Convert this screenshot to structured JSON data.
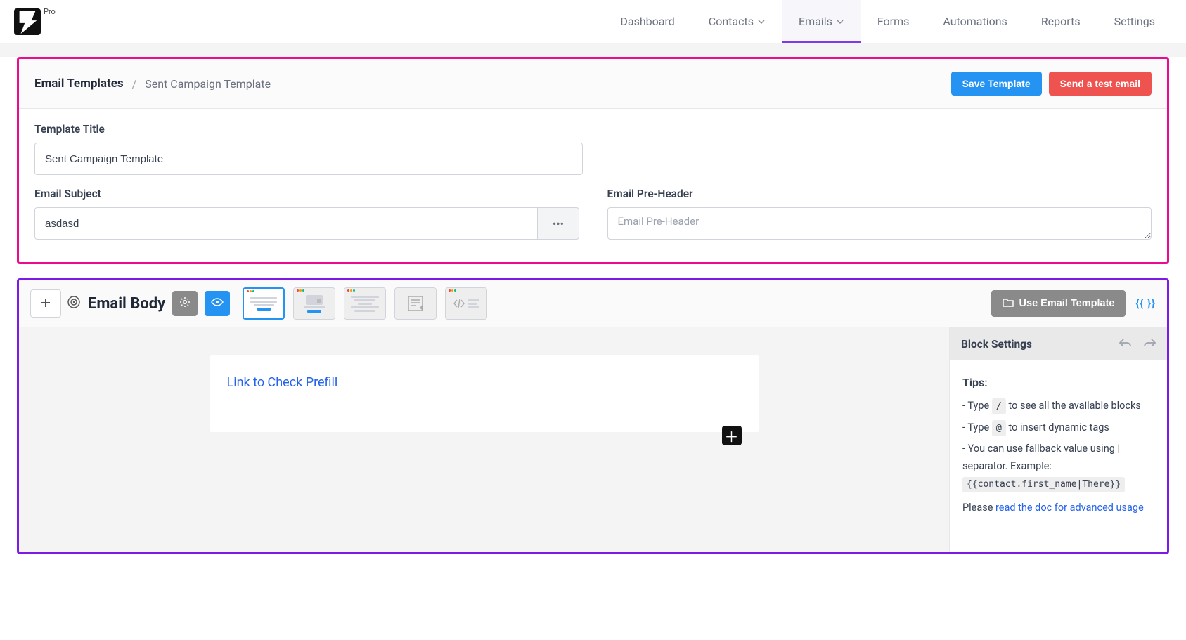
{
  "brand": {
    "badge": "Pro"
  },
  "nav": {
    "dashboard": "Dashboard",
    "contacts": "Contacts",
    "emails": "Emails",
    "forms": "Forms",
    "automations": "Automations",
    "reports": "Reports",
    "settings": "Settings"
  },
  "header": {
    "breadcrumb_root": "Email Templates",
    "breadcrumb_tail": "Sent Campaign Template",
    "save_btn": "Save Template",
    "test_btn": "Send a test email"
  },
  "form": {
    "title_label": "Template Title",
    "title_value": "Sent Campaign Template",
    "subject_label": "Email Subject",
    "subject_value": "asdasd",
    "preheader_label": "Email Pre-Header",
    "preheader_placeholder": "Email Pre-Header",
    "preheader_value": ""
  },
  "editor": {
    "body_label": "Email Body",
    "use_template_btn": "Use Email Template",
    "shortcode_btn": "{{ }}",
    "canvas_link": "Link to Check Prefill",
    "sidebar": {
      "title": "Block Settings",
      "tips_head": "Tips:",
      "tip1_prefix": "- Type",
      "tip1_kbd": "/",
      "tip1_suffix": "to see all the available blocks",
      "tip2_prefix": "- Type",
      "tip2_kbd": "@",
      "tip2_suffix": "to insert dynamic tags",
      "tip3": "- You can use fallback value using | separator. Example:",
      "tip3_code": "{{contact.first_name|There}}",
      "doc_prefix": "Please ",
      "doc_link": "read the doc for advanced usage"
    }
  }
}
